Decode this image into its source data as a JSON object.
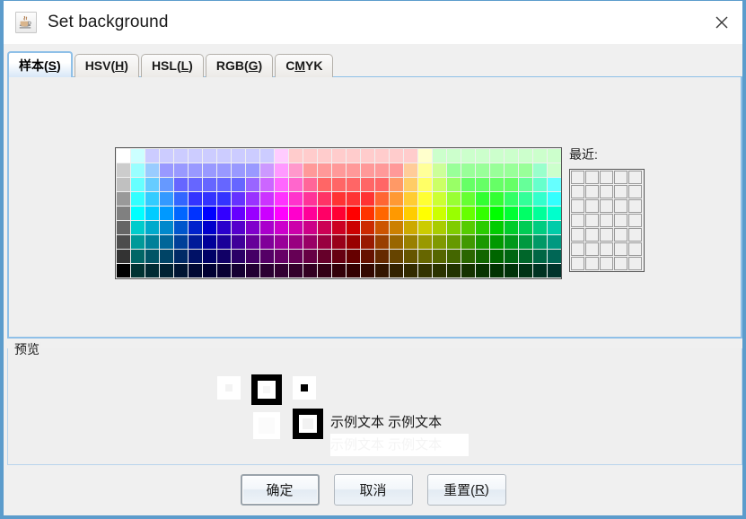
{
  "window": {
    "title": "Set background",
    "icon": "java-coffee-cup-icon",
    "close_label": "✕",
    "frame_color": "#5c9ccc"
  },
  "tabs": [
    {
      "label": "样本(S)",
      "mnemonic": "S",
      "selected": true
    },
    {
      "label": "HSV(H)",
      "mnemonic": "H",
      "selected": false
    },
    {
      "label": "HSL(L)",
      "mnemonic": "L",
      "selected": false
    },
    {
      "label": "RGB(G)",
      "mnemonic": "G",
      "selected": false
    },
    {
      "label": "CMYK",
      "mnemonic": "M",
      "selected": false
    }
  ],
  "swatches": {
    "columns": 31,
    "rows": 9,
    "recent_label": "最近:",
    "recent_columns": 5,
    "recent_rows": 7,
    "recent_empty_color": "#efefef",
    "grid_colors": [
      "#ffffff",
      "#ccffff",
      "#ccccff",
      "#ccccff",
      "#ccccff",
      "#ccccff",
      "#ccccff",
      "#ccccff",
      "#ccccff",
      "#ccccff",
      "#ccccff",
      "#ffccff",
      "#ffcccc",
      "#ffcccc",
      "#ffcccc",
      "#ffcccc",
      "#ffcccc",
      "#ffcccc",
      "#ffcccc",
      "#ffcccc",
      "#ffcccc",
      "#ffffcc",
      "#ccffcc",
      "#ccffcc",
      "#ccffcc",
      "#ccffcc",
      "#ccffcc",
      "#ccffcc",
      "#ccffcc",
      "#ccffcc",
      "#ccffcc",
      "#cccccc",
      "#99ffff",
      "#99ccff",
      "#9999ff",
      "#9999ff",
      "#9999ff",
      "#9999ff",
      "#9999ff",
      "#9999ff",
      "#9999ff",
      "#cc99ff",
      "#ff99ff",
      "#ff99cc",
      "#ff9999",
      "#ff9999",
      "#ff9999",
      "#ff9999",
      "#ff9999",
      "#ff9999",
      "#ff9999",
      "#ffcc99",
      "#ffff99",
      "#ccff99",
      "#99ff99",
      "#99ff99",
      "#99ff99",
      "#99ff99",
      "#99ff99",
      "#99ff99",
      "#99ffcc",
      "#ccffcc",
      "#c0c0c0",
      "#66ffff",
      "#66ccff",
      "#6699ff",
      "#6666ff",
      "#6666ff",
      "#6666ff",
      "#6666ff",
      "#6666ff",
      "#9966ff",
      "#cc66ff",
      "#ff66ff",
      "#ff66cc",
      "#ff6699",
      "#ff6666",
      "#ff6666",
      "#ff6666",
      "#ff6666",
      "#ff6666",
      "#ff9966",
      "#ffcc66",
      "#ffff66",
      "#ccff66",
      "#99ff66",
      "#66ff66",
      "#66ff66",
      "#66ff66",
      "#66ff66",
      "#66ff99",
      "#66ffcc",
      "#66ffff",
      "#999999",
      "#33ffff",
      "#33ccff",
      "#3399ff",
      "#3366ff",
      "#3333ff",
      "#3333ff",
      "#3333ff",
      "#6633ff",
      "#9933ff",
      "#cc33ff",
      "#ff33ff",
      "#ff33cc",
      "#ff3399",
      "#ff3366",
      "#ff3333",
      "#ff3333",
      "#ff3333",
      "#ff6633",
      "#ff9933",
      "#ffcc33",
      "#ffff33",
      "#ccff33",
      "#99ff33",
      "#66ff33",
      "#33ff33",
      "#33ff33",
      "#33ff66",
      "#33ff99",
      "#33ffcc",
      "#33ffff",
      "#808080",
      "#00ffff",
      "#00ccff",
      "#0099ff",
      "#0066ff",
      "#0033ff",
      "#0000ff",
      "#3300ff",
      "#6600ff",
      "#9900ff",
      "#cc00ff",
      "#ff00ff",
      "#ff00cc",
      "#ff0099",
      "#ff0066",
      "#ff0033",
      "#ff0000",
      "#ff3300",
      "#ff6600",
      "#ff9900",
      "#ffcc00",
      "#ffff00",
      "#ccff00",
      "#99ff00",
      "#66ff00",
      "#33ff00",
      "#00ff00",
      "#00ff33",
      "#00ff66",
      "#00ff99",
      "#00ffcc",
      "#666666",
      "#00cccc",
      "#00aacc",
      "#0088cc",
      "#0055cc",
      "#0022cc",
      "#0000cc",
      "#2a00cc",
      "#5500cc",
      "#8000cc",
      "#aa00cc",
      "#cc00cc",
      "#cc00aa",
      "#cc0088",
      "#cc0055",
      "#cc0022",
      "#cc0000",
      "#cc2a00",
      "#cc5500",
      "#cc8000",
      "#cca900",
      "#cccc00",
      "#a9cc00",
      "#80cc00",
      "#55cc00",
      "#2acc00",
      "#00cc00",
      "#00cc2a",
      "#00cc55",
      "#00cc80",
      "#00cca9",
      "#4d4d4d",
      "#009999",
      "#008099",
      "#006699",
      "#004099",
      "#001a99",
      "#000099",
      "#1a0099",
      "#400099",
      "#660099",
      "#800099",
      "#990099",
      "#990080",
      "#990066",
      "#990040",
      "#99001a",
      "#990000",
      "#991a00",
      "#994000",
      "#996600",
      "#998000",
      "#999900",
      "#809900",
      "#669900",
      "#409900",
      "#1a9900",
      "#009900",
      "#00991a",
      "#009940",
      "#009966",
      "#009980",
      "#333333",
      "#006666",
      "#005566",
      "#004466",
      "#002a66",
      "#001166",
      "#000066",
      "#110066",
      "#2a0066",
      "#440066",
      "#550066",
      "#660066",
      "#660055",
      "#660044",
      "#66002a",
      "#660011",
      "#660000",
      "#661100",
      "#662a00",
      "#664400",
      "#665500",
      "#666600",
      "#556600",
      "#446600",
      "#2a6600",
      "#116600",
      "#006600",
      "#006611",
      "#00662a",
      "#006644",
      "#006655",
      "#000000",
      "#003333",
      "#002b33",
      "#002233",
      "#001533",
      "#000833",
      "#000033",
      "#080033",
      "#150033",
      "#220033",
      "#2b0033",
      "#330033",
      "#33002b",
      "#330022",
      "#330015",
      "#330008",
      "#330000",
      "#330800",
      "#331500",
      "#332200",
      "#332b00",
      "#333300",
      "#2b3300",
      "#223300",
      "#153300",
      "#083300",
      "#003300",
      "#003308",
      "#003315",
      "#003322",
      "#00332b"
    ]
  },
  "preview": {
    "title": "预览",
    "sample_text_dark": "示例文本 示例文本",
    "sample_text_light": "示例文本 示例文本"
  },
  "buttons": [
    {
      "label": "确定",
      "mnemonic": "",
      "default": true
    },
    {
      "label": "取消",
      "mnemonic": "",
      "default": false
    },
    {
      "label": "重置(R)",
      "mnemonic": "R",
      "default": false
    }
  ]
}
